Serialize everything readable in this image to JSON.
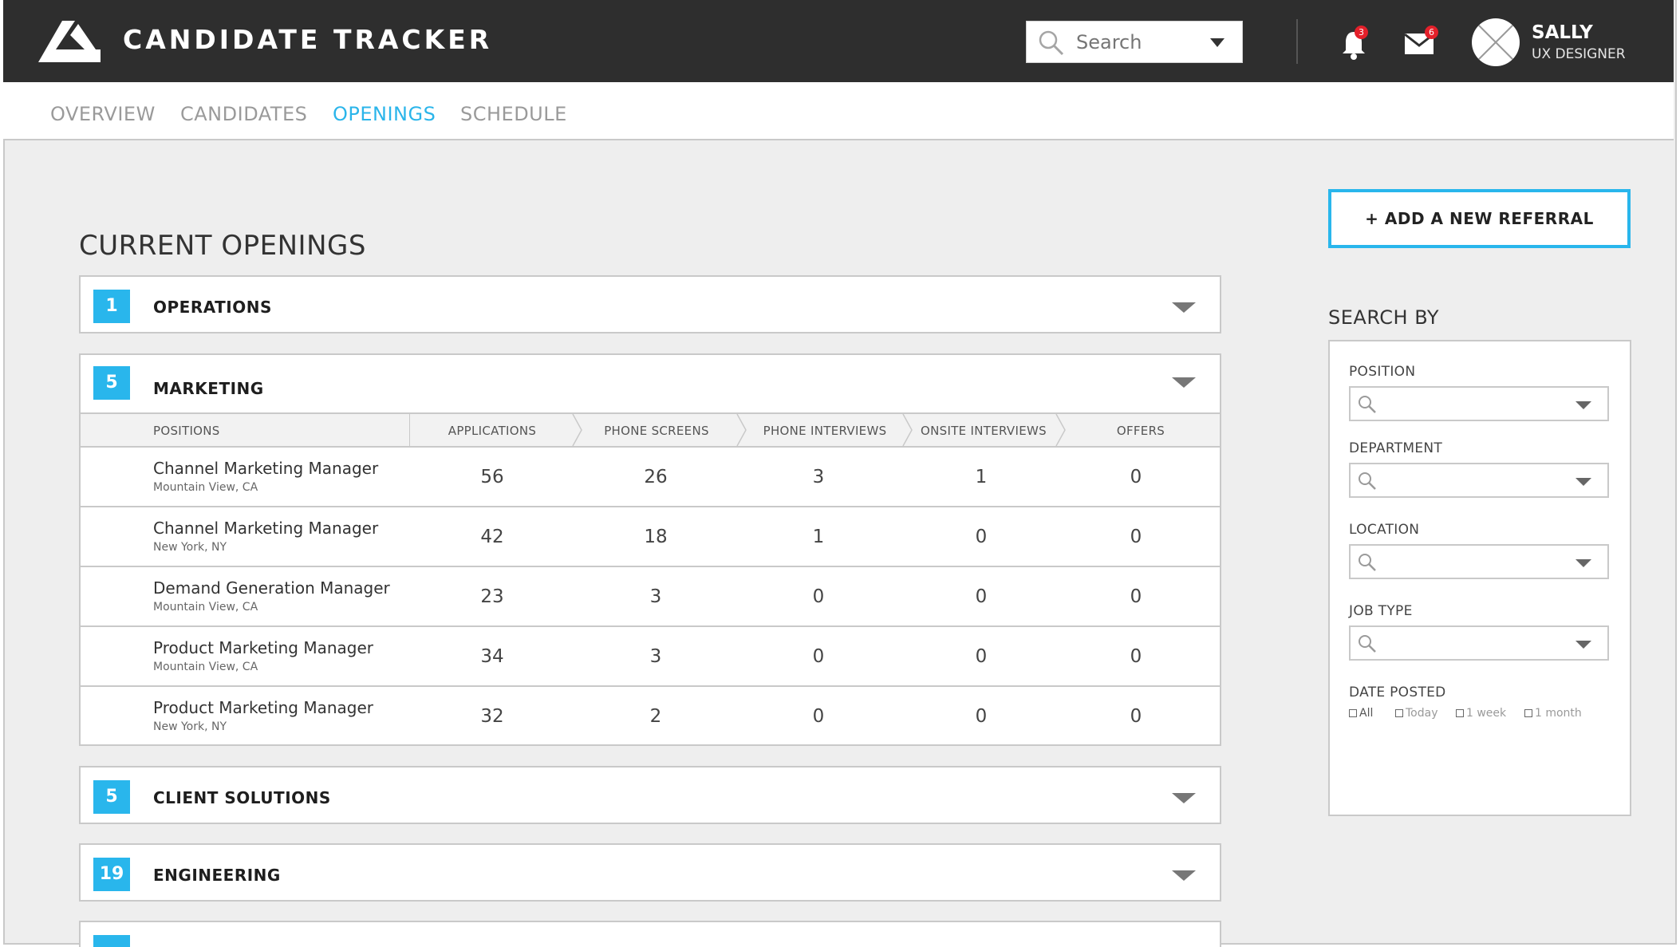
{
  "app": {
    "title": "CANDIDATE TRACKER"
  },
  "header": {
    "search_placeholder": "Search",
    "notifications_count": "3",
    "messages_count": "6",
    "user_name": "SALLY",
    "user_role": "UX DESIGNER"
  },
  "nav": {
    "tabs": [
      {
        "label": "OVERVIEW"
      },
      {
        "label": "CANDIDATES"
      },
      {
        "label": "OPENINGS",
        "active": true
      },
      {
        "label": "SCHEDULE"
      }
    ]
  },
  "main": {
    "title": "CURRENT OPENINGS",
    "departments": [
      {
        "name": "OPERATIONS",
        "count": "1",
        "expanded": false
      },
      {
        "name": "MARKETING",
        "count": "5",
        "expanded": true
      },
      {
        "name": "CLIENT SOLUTIONS",
        "count": "5",
        "expanded": false
      },
      {
        "name": "ENGINEERING",
        "count": "19",
        "expanded": false
      }
    ],
    "table": {
      "headers": [
        "POSITIONS",
        "APPLICATIONS",
        "PHONE SCREENS",
        "PHONE INTERVIEWS",
        "ONSITE INTERVIEWS",
        "OFFERS"
      ],
      "rows": [
        {
          "title": "Channel Marketing Manager",
          "location": "Mountain View, CA",
          "applications": "56",
          "phone_screens": "26",
          "phone_interviews": "3",
          "onsite_interviews": "1",
          "offers": "0"
        },
        {
          "title": "Channel Marketing Manager",
          "location": "New York, NY",
          "applications": "42",
          "phone_screens": "18",
          "phone_interviews": "1",
          "onsite_interviews": "0",
          "offers": "0"
        },
        {
          "title": "Demand Generation Manager",
          "location": "Mountain View, CA",
          "applications": "23",
          "phone_screens": "3",
          "phone_interviews": "0",
          "onsite_interviews": "0",
          "offers": "0"
        },
        {
          "title": "Product Marketing Manager",
          "location": "Mountain View, CA",
          "applications": "34",
          "phone_screens": "3",
          "phone_interviews": "0",
          "onsite_interviews": "0",
          "offers": "0"
        },
        {
          "title": "Product Marketing Manager",
          "location": "New York, NY",
          "applications": "32",
          "phone_screens": "2",
          "phone_interviews": "0",
          "onsite_interviews": "0",
          "offers": "0"
        }
      ]
    }
  },
  "sidebar": {
    "add_referral_label": "+ ADD A NEW REFERRAL",
    "search_by_title": "SEARCH BY",
    "filters": [
      {
        "label": "POSITION",
        "value": ""
      },
      {
        "label": "DEPARTMENT",
        "value": ""
      },
      {
        "label": "LOCATION",
        "value": ""
      },
      {
        "label": "JOB TYPE",
        "value": ""
      }
    ],
    "date_posted": {
      "label": "DATE POSTED",
      "options": [
        "All",
        "Today",
        "1 week",
        "1 month"
      ]
    }
  },
  "colors": {
    "accent": "#29b6ec",
    "header_bg": "#2e2e2e",
    "badge": "#e4202a",
    "page_bg": "#eeeeee"
  },
  "icons": {
    "logo": "brand-logo-icon",
    "search": "search-icon",
    "notifications": "bell-icon",
    "messages": "mail-icon",
    "avatar": "avatar-placeholder-icon",
    "dropdown": "chevron-down-icon"
  }
}
